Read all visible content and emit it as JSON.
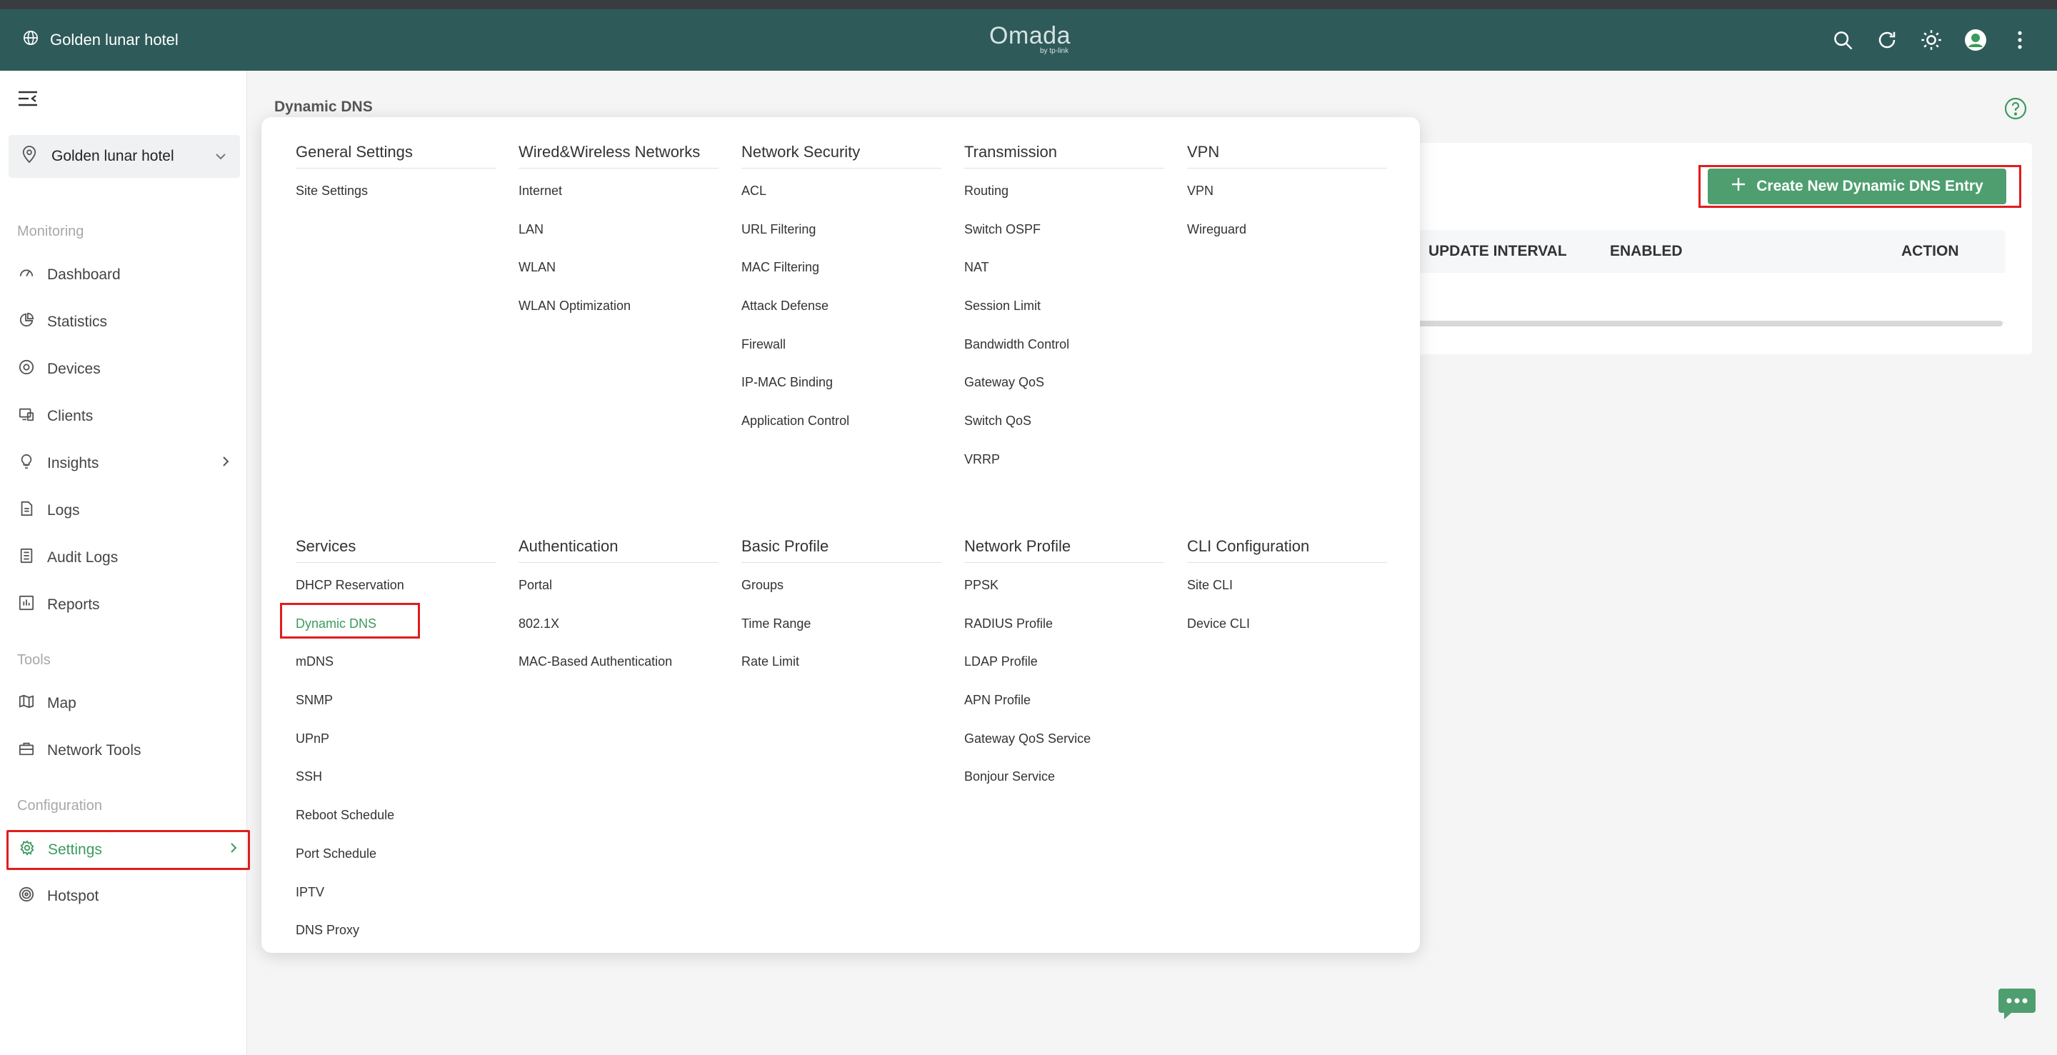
{
  "topbar": {
    "site_name": "Golden lunar hotel",
    "logo_main": "Omada",
    "logo_sub": "by tp-link",
    "icons": [
      "search-icon",
      "refresh-icon",
      "theme-sun-icon",
      "avatar",
      "more-vertical-icon"
    ],
    "bg_color": "#2f5a5a"
  },
  "sidebar": {
    "site_select": "Golden lunar hotel",
    "sections": {
      "monitoring": "Monitoring",
      "tools": "Tools",
      "configuration": "Configuration"
    },
    "monitoring_items": [
      {
        "label": "Dashboard",
        "icon": "dashboard-icon"
      },
      {
        "label": "Statistics",
        "icon": "pie-chart-icon"
      },
      {
        "label": "Devices",
        "icon": "devices-icon"
      },
      {
        "label": "Clients",
        "icon": "clients-icon"
      },
      {
        "label": "Insights",
        "icon": "bulb-icon"
      },
      {
        "label": "Logs",
        "icon": "document-icon"
      },
      {
        "label": "Audit Logs",
        "icon": "list-icon"
      },
      {
        "label": "Reports",
        "icon": "bar-chart-icon"
      }
    ],
    "tools_items": [
      {
        "label": "Map",
        "icon": "map-icon"
      },
      {
        "label": "Network Tools",
        "icon": "toolbox-icon"
      }
    ],
    "config_items": [
      {
        "label": "Settings",
        "icon": "gear-icon",
        "active": true
      },
      {
        "label": "Hotspot",
        "icon": "hotspot-icon"
      }
    ],
    "accent_color": "#3c9a5f"
  },
  "main": {
    "page_title": "Dynamic DNS",
    "create_button": "Create New Dynamic DNS Entry",
    "table_headers": {
      "update_interval": "UPDATE INTERVAL",
      "enabled": "ENABLED",
      "action": "ACTION"
    }
  },
  "menu": {
    "row1": [
      {
        "title": "General Settings",
        "items": [
          "Site Settings"
        ]
      },
      {
        "title": "Wired&Wireless Networks",
        "items": [
          "Internet",
          "LAN",
          "WLAN",
          "WLAN Optimization"
        ]
      },
      {
        "title": "Network Security",
        "items": [
          "ACL",
          "URL Filtering",
          "MAC Filtering",
          "Attack Defense",
          "Firewall",
          "IP-MAC Binding",
          "Application Control"
        ]
      },
      {
        "title": "Transmission",
        "items": [
          "Routing",
          "Switch OSPF",
          "NAT",
          "Session Limit",
          "Bandwidth Control",
          "Gateway QoS",
          "Switch QoS",
          "VRRP"
        ]
      },
      {
        "title": "VPN",
        "items": [
          "VPN",
          "Wireguard"
        ]
      }
    ],
    "row2": [
      {
        "title": "Services",
        "items": [
          "DHCP Reservation",
          "Dynamic DNS",
          "mDNS",
          "SNMP",
          "UPnP",
          "SSH",
          "Reboot Schedule",
          "Port Schedule",
          "IPTV",
          "DNS Proxy"
        ]
      },
      {
        "title": "Authentication",
        "items": [
          "Portal",
          "802.1X",
          "MAC-Based Authentication"
        ]
      },
      {
        "title": "Basic Profile",
        "items": [
          "Groups",
          "Time Range",
          "Rate Limit"
        ]
      },
      {
        "title": "Network Profile",
        "items": [
          "PPSK",
          "RADIUS Profile",
          "LDAP Profile",
          "APN Profile",
          "Gateway QoS Service",
          "Bonjour Service"
        ]
      },
      {
        "title": "CLI Configuration",
        "items": [
          "Site CLI",
          "Device CLI"
        ]
      }
    ],
    "active_item": "Dynamic DNS"
  }
}
